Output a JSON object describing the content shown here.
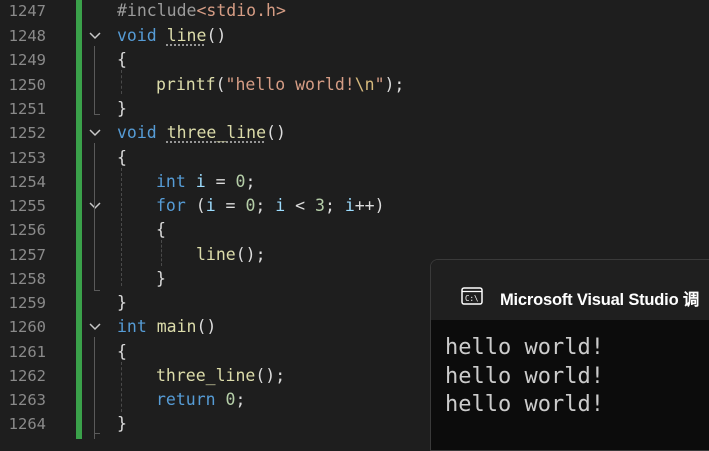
{
  "editor": {
    "line_numbers": [
      "1247",
      "1248",
      "1249",
      "1250",
      "1251",
      "1252",
      "1253",
      "1254",
      "1255",
      "1256",
      "1257",
      "1258",
      "1259",
      "1260",
      "1261",
      "1262",
      "1263",
      "1264"
    ],
    "change_bar_color": "#3aa14a",
    "lines": {
      "l1247": {
        "pre": "#include",
        "inc": "<stdio.h>"
      },
      "l1248": {
        "kw": "void",
        "fn": "line",
        "rest": "()"
      },
      "l1249": {
        "text": "{"
      },
      "l1250": {
        "fn": "printf",
        "open": "(",
        "str": "\"hello world!",
        "esc": "\\n",
        "strend": "\"",
        "close": ");"
      },
      "l1251": {
        "text": "}"
      },
      "l1252": {
        "kw": "void",
        "fn": "three_line",
        "rest": "()"
      },
      "l1253": {
        "text": "{"
      },
      "l1254": {
        "kw": "int",
        "var": "i",
        "eq": " = ",
        "num": "0",
        "end": ";"
      },
      "l1255": {
        "kw": "for",
        "p1": " (",
        "v1": "i",
        "p2": " = ",
        "n1": "0",
        "p3": "; ",
        "v2": "i",
        "p4": " < ",
        "n2": "3",
        "p5": "; ",
        "v3": "i",
        "p6": "++)"
      },
      "l1256": {
        "text": "{"
      },
      "l1257": {
        "fn": "line",
        "rest": "();"
      },
      "l1258": {
        "text": "}"
      },
      "l1259": {
        "text": "}"
      },
      "l1260": {
        "kw": "int",
        "fn": "main",
        "rest": "()"
      },
      "l1261": {
        "text": "{"
      },
      "l1262": {
        "fn": "three_line",
        "rest": "();"
      },
      "l1263": {
        "kw": "return",
        "num": "0",
        "end": ";"
      },
      "l1264": {
        "text": "}"
      }
    }
  },
  "console": {
    "icon": "console-icon",
    "title": "Microsoft Visual Studio 调",
    "output": [
      "hello world!",
      "hello world!",
      "hello world!"
    ]
  }
}
